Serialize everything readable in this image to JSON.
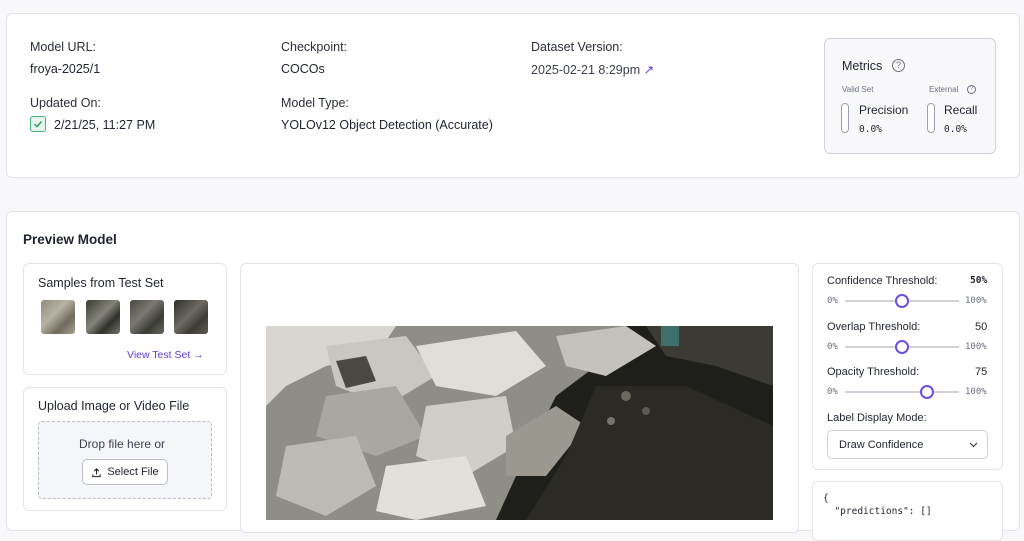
{
  "info": {
    "model_url_label": "Model URL:",
    "model_url_value": "froya-2025/1",
    "checkpoint_label": "Checkpoint:",
    "checkpoint_value": "COCOs",
    "dataset_label": "Dataset Version:",
    "dataset_value": "2025-02-21 8:29pm",
    "dataset_link_icon": "↗",
    "updated_label": "Updated On:",
    "updated_value": "2/21/25, 11:27 PM",
    "type_label": "Model Type:",
    "type_value": "YOLOv12 Object Detection (Accurate)"
  },
  "metrics": {
    "title": "Metrics",
    "help_icon": "?",
    "valid_set": "Valid Set",
    "external": "External",
    "precision_label": "Precision",
    "precision_value": "0.0%",
    "recall_label": "Recall",
    "recall_value": "0.0%"
  },
  "preview": {
    "title": "Preview Model",
    "samples_title": "Samples from Test Set",
    "view_test_set": "View Test Set →",
    "upload_title": "Upload Image or Video File",
    "drop_text": "Drop file here or",
    "select_file": "Select File"
  },
  "controls": {
    "confidence_label": "Confidence Threshold:",
    "confidence_value": "50%",
    "confidence_level": 50,
    "overlap_label": "Overlap Threshold:",
    "overlap_value": "50",
    "overlap_level": 50,
    "opacity_label": "Opacity Threshold:",
    "opacity_value": "75",
    "opacity_level": 75,
    "min_label": "0%",
    "max_label": "100%",
    "display_mode_label": "Label Display Mode:",
    "display_mode_value": "Draw Confidence",
    "json_line1": "{",
    "json_line2": "  \"predictions\": []"
  }
}
